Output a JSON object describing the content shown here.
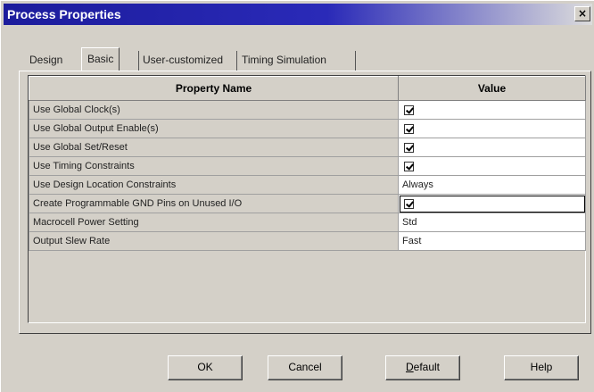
{
  "window": {
    "title": "Process Properties",
    "close_label": "×"
  },
  "tabs": [
    {
      "label": "Design",
      "active": false
    },
    {
      "label": "Basic",
      "active": true
    },
    {
      "label": "User-customized",
      "active": false
    },
    {
      "label": "Timing Simulation",
      "active": false
    }
  ],
  "table": {
    "headers": [
      "Property Name",
      "Value"
    ],
    "rows": [
      {
        "name": "Use Global Clock(s)",
        "type": "checkbox",
        "checked": true
      },
      {
        "name": "Use Global Output Enable(s)",
        "type": "checkbox",
        "checked": true
      },
      {
        "name": "Use Global Set/Reset",
        "type": "checkbox",
        "checked": true
      },
      {
        "name": "Use Timing Constraints",
        "type": "checkbox",
        "checked": true
      },
      {
        "name": "Use Design Location Constraints",
        "type": "text",
        "value": "Always"
      },
      {
        "name": "Create Programmable GND Pins on Unused I/O",
        "type": "checkbox",
        "checked": true
      },
      {
        "name": "Macrocell Power Setting",
        "type": "text",
        "value": "Std"
      },
      {
        "name": "Output Slew Rate",
        "type": "text",
        "value": "Fast"
      }
    ]
  },
  "buttons": {
    "ok": "OK",
    "cancel": "Cancel",
    "default_u": "D",
    "default_rest": "efault",
    "help": "Help"
  }
}
